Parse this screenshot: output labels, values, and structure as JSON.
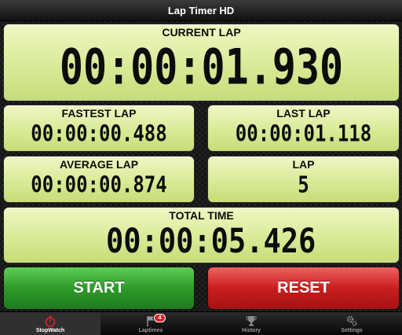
{
  "app": {
    "title": "Lap Timer HD"
  },
  "current_lap": {
    "label": "CURRENT LAP",
    "value": "00:00:01.930"
  },
  "fastest_lap": {
    "label": "FASTEST LAP",
    "value": "00:00:00.488"
  },
  "last_lap": {
    "label": "LAST LAP",
    "value": "00:00:01.118"
  },
  "average_lap": {
    "label": "AVERAGE LAP",
    "value": "00:00:00.874"
  },
  "lap_count": {
    "label": "LAP",
    "value": "5"
  },
  "total_time": {
    "label": "TOTAL TIME",
    "value": "00:00:05.426"
  },
  "buttons": {
    "start": "START",
    "reset": "RESET"
  },
  "tabs": [
    {
      "label": "StopWatch",
      "icon": "stopwatch-icon",
      "active": true
    },
    {
      "label": "Laptimes",
      "icon": "flag-icon",
      "badge": "4"
    },
    {
      "label": "History",
      "icon": "trophy-icon"
    },
    {
      "label": "Settings",
      "icon": "gears-icon"
    }
  ],
  "colors": {
    "panel": "#d9ea97",
    "start": "#2f9a2a",
    "reset": "#c81e1e",
    "active_icon": "#e02222"
  }
}
